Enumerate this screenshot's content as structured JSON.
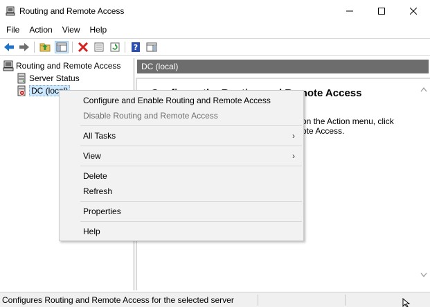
{
  "window": {
    "title": "Routing and Remote Access",
    "icon": "rras-server-icon"
  },
  "menubar": {
    "items": [
      "File",
      "Action",
      "View",
      "Help"
    ]
  },
  "toolbar": {
    "buttons": [
      "back-arrow-icon",
      "forward-arrow-icon",
      "up-folder-icon",
      "show-hide-tree-icon",
      "delete-icon",
      "properties-icon",
      "refresh-icon",
      "help-icon",
      "show-hide-action-pane-icon"
    ]
  },
  "tree": {
    "root": "Routing and Remote Access",
    "items": [
      {
        "label": "Server Status"
      },
      {
        "label": "DC (local)"
      }
    ]
  },
  "content": {
    "header": "DC (local)",
    "heading": "Configure the Routing and Remote Access",
    "text_line1": "on the Action menu, click",
    "text_line2": "ote Access."
  },
  "context_menu": {
    "items": [
      {
        "label": "Configure and Enable Routing and Remote Access",
        "enabled": true
      },
      {
        "label": "Disable Routing and Remote Access",
        "enabled": false
      },
      {
        "label": "All Tasks",
        "submenu": true
      },
      {
        "label": "View",
        "submenu": true
      },
      {
        "label": "Delete"
      },
      {
        "label": "Refresh"
      },
      {
        "label": "Properties"
      },
      {
        "label": "Help"
      }
    ],
    "submenu_arrow": "›"
  },
  "statusbar": {
    "text": "Configures Routing and Remote Access for the selected server"
  },
  "colors": {
    "header_bg": "#6d6d6d",
    "menu_bg": "#f2f2f2",
    "selection": "#cce8ff"
  }
}
